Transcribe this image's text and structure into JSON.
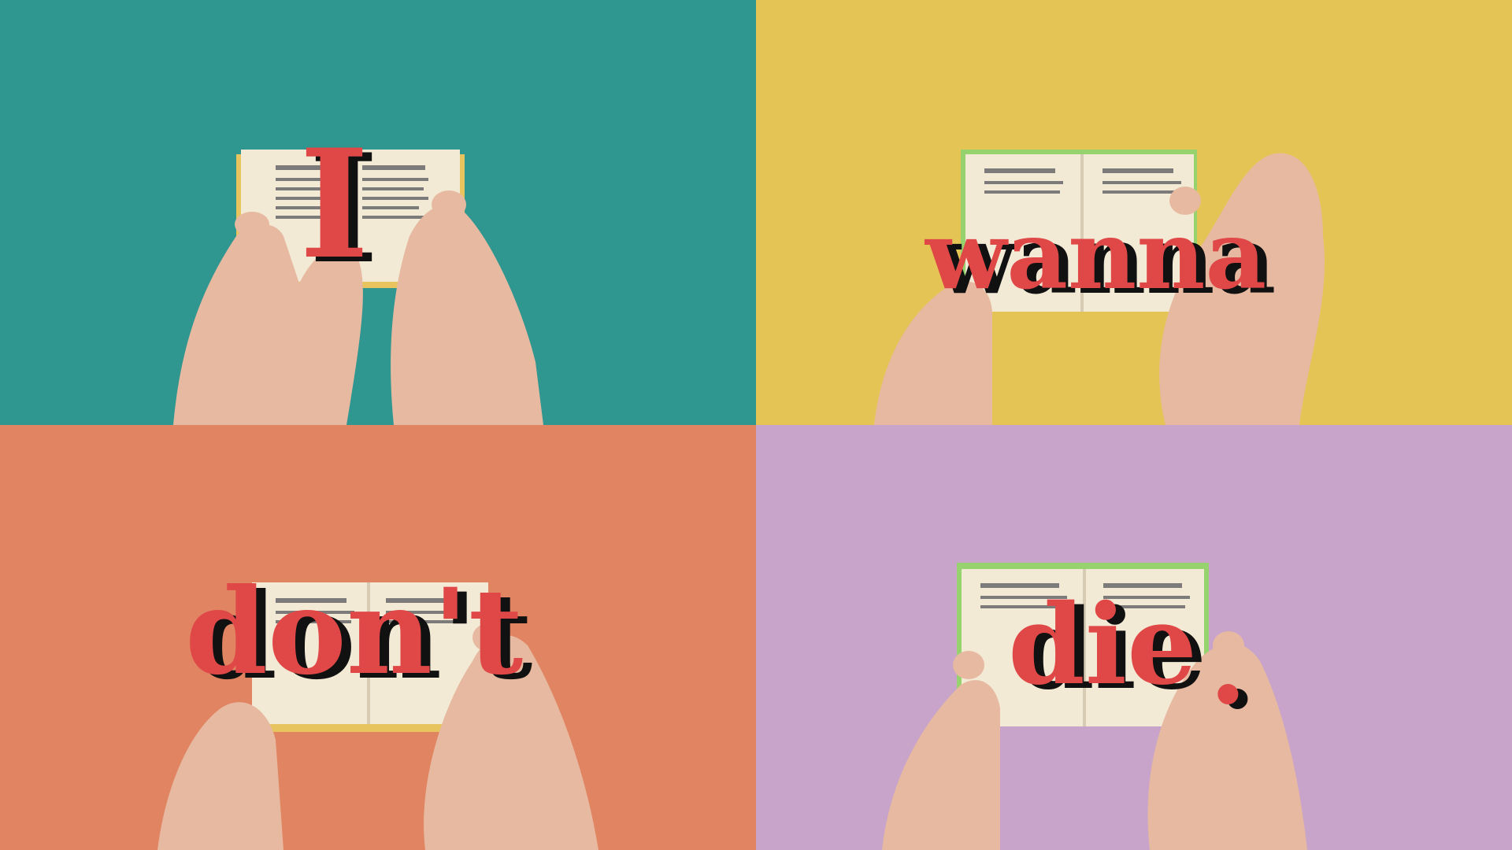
{
  "video": {
    "panels": [
      {
        "id": "top-left",
        "background": "#2f9690",
        "word": "I"
      },
      {
        "id": "top-right",
        "background": "#e5c456",
        "word": "wanna"
      },
      {
        "id": "bottom-left",
        "background": "#e08461",
        "word": "don't"
      },
      {
        "id": "bottom-right",
        "background": "#c8a4cb",
        "word": "die",
        "punct": "."
      }
    ],
    "colors": {
      "text_front": "#e04848",
      "text_shadow": "#111111",
      "skin": "#e6b9a0",
      "paper": "#f3ead6"
    }
  }
}
